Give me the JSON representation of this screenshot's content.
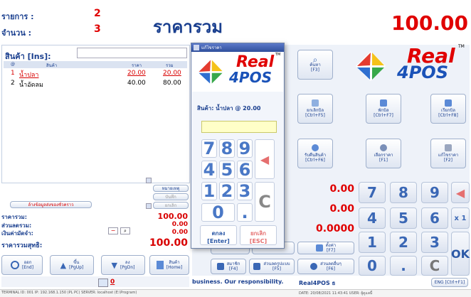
{
  "header": {
    "items_label": "รายการ :",
    "items_value": "2",
    "qty_label": "จำนวน :",
    "qty_value": "3",
    "total_label": "ราคารวม",
    "total_value": "100.00"
  },
  "products": {
    "title": "สินค้า [Ins]:",
    "input_value": "",
    "columns": [
      "@",
      "สินค้า",
      "ราคา",
      "รวม"
    ],
    "rows": [
      {
        "no": "1",
        "name": "น้ำปลา",
        "price": "20.00",
        "total": "20.00"
      },
      {
        "no": "2",
        "name": "น้ำอัดลม",
        "price": "40.00",
        "total": "80.00"
      }
    ]
  },
  "side_small_buttons": [
    "หมายเหตุ",
    "บันทึก",
    "ยกเลิก"
  ],
  "summary": {
    "link": "ล้างข้อมูลส่งของชั่วคราว",
    "subtotal_label": "ราคารวม:",
    "subtotal_value": "100.00",
    "discount_label": "ส่วนลดรวม:",
    "discount_value": "0.00",
    "deposit_label": "เงินค่ามัดจำ:",
    "deposit_value": "0.00",
    "net_label": "ราคารวมสุทธิ:",
    "net_value": "100.00"
  },
  "bottom_buttons": [
    {
      "label": "ออก",
      "key": "[End]"
    },
    {
      "label": "ขึ้น",
      "key": "[PgUp]"
    },
    {
      "label": "ลง",
      "key": "[PgDn]"
    },
    {
      "label": "สินค้า",
      "key": "[Home]"
    }
  ],
  "user_badge": "0",
  "function_buttons": [
    {
      "label": "ค้นหา",
      "key": "[F3]"
    },
    {
      "label": "ยกเลิกบิล",
      "key": "[Ctrl+F5]"
    },
    {
      "label": "พักบิล",
      "key": "[Ctrl+F7]"
    },
    {
      "label": "เรียกบิล",
      "key": "[Ctrl+F8]"
    },
    {
      "label": "รับคืนสินค้า",
      "key": "[Ctrl+F6]"
    },
    {
      "label": "เลือกราคา",
      "key": "[F1]"
    },
    {
      "label": "แก้ไขราคา",
      "key": "[F2]"
    }
  ],
  "lower_buttons": [
    {
      "label": "ตั้งค่า",
      "key": "[F7]"
    },
    {
      "label": "สมาชิก",
      "key": "[F4]"
    },
    {
      "label": "ส่วนลดรูปแบบ",
      "key": "[F5]"
    },
    {
      "label": "ส่วนลดอื่นๆ",
      "key": "[F6]"
    }
  ],
  "payment": {
    "value1": "0.00",
    "value2": "0.00",
    "value3": "0.0000"
  },
  "keypad": [
    "7",
    "8",
    "9",
    "4",
    "5",
    "6",
    "1",
    "2",
    "3",
    "0",
    "."
  ],
  "keypad_x1": "x 1",
  "keypad_ok": "OK",
  "keypad_c": "C",
  "logo": {
    "line1": "Real",
    "line2": "4POS",
    "tm": "TM"
  },
  "dialog": {
    "title": "แก้ไขราคา",
    "product_text": "สินค้า: น้ำปลา @ 20.00",
    "input_value": "",
    "keys": [
      "7",
      "8",
      "9",
      "4",
      "5",
      "6",
      "1",
      "2",
      "3",
      "0",
      "."
    ],
    "c_label": "C",
    "ok_label": "ตกลง",
    "ok_key": "[Enter]",
    "cancel_label": "ยกเลิก",
    "cancel_key": "[ESC]"
  },
  "ticker": "business. Our responsibility.",
  "ticker_brand": "Real4POS ธ",
  "lang_button": "ENG [Ctrl+F1]",
  "status_left": "TERMINAL ID: 001   IP: 192.168.1.150 (PL PC)   SERVER: localhost (E:\\Program)",
  "status_right": "DATE: 20/08/2021 11:43:41   USER: ผู้ดูแลนี้"
}
